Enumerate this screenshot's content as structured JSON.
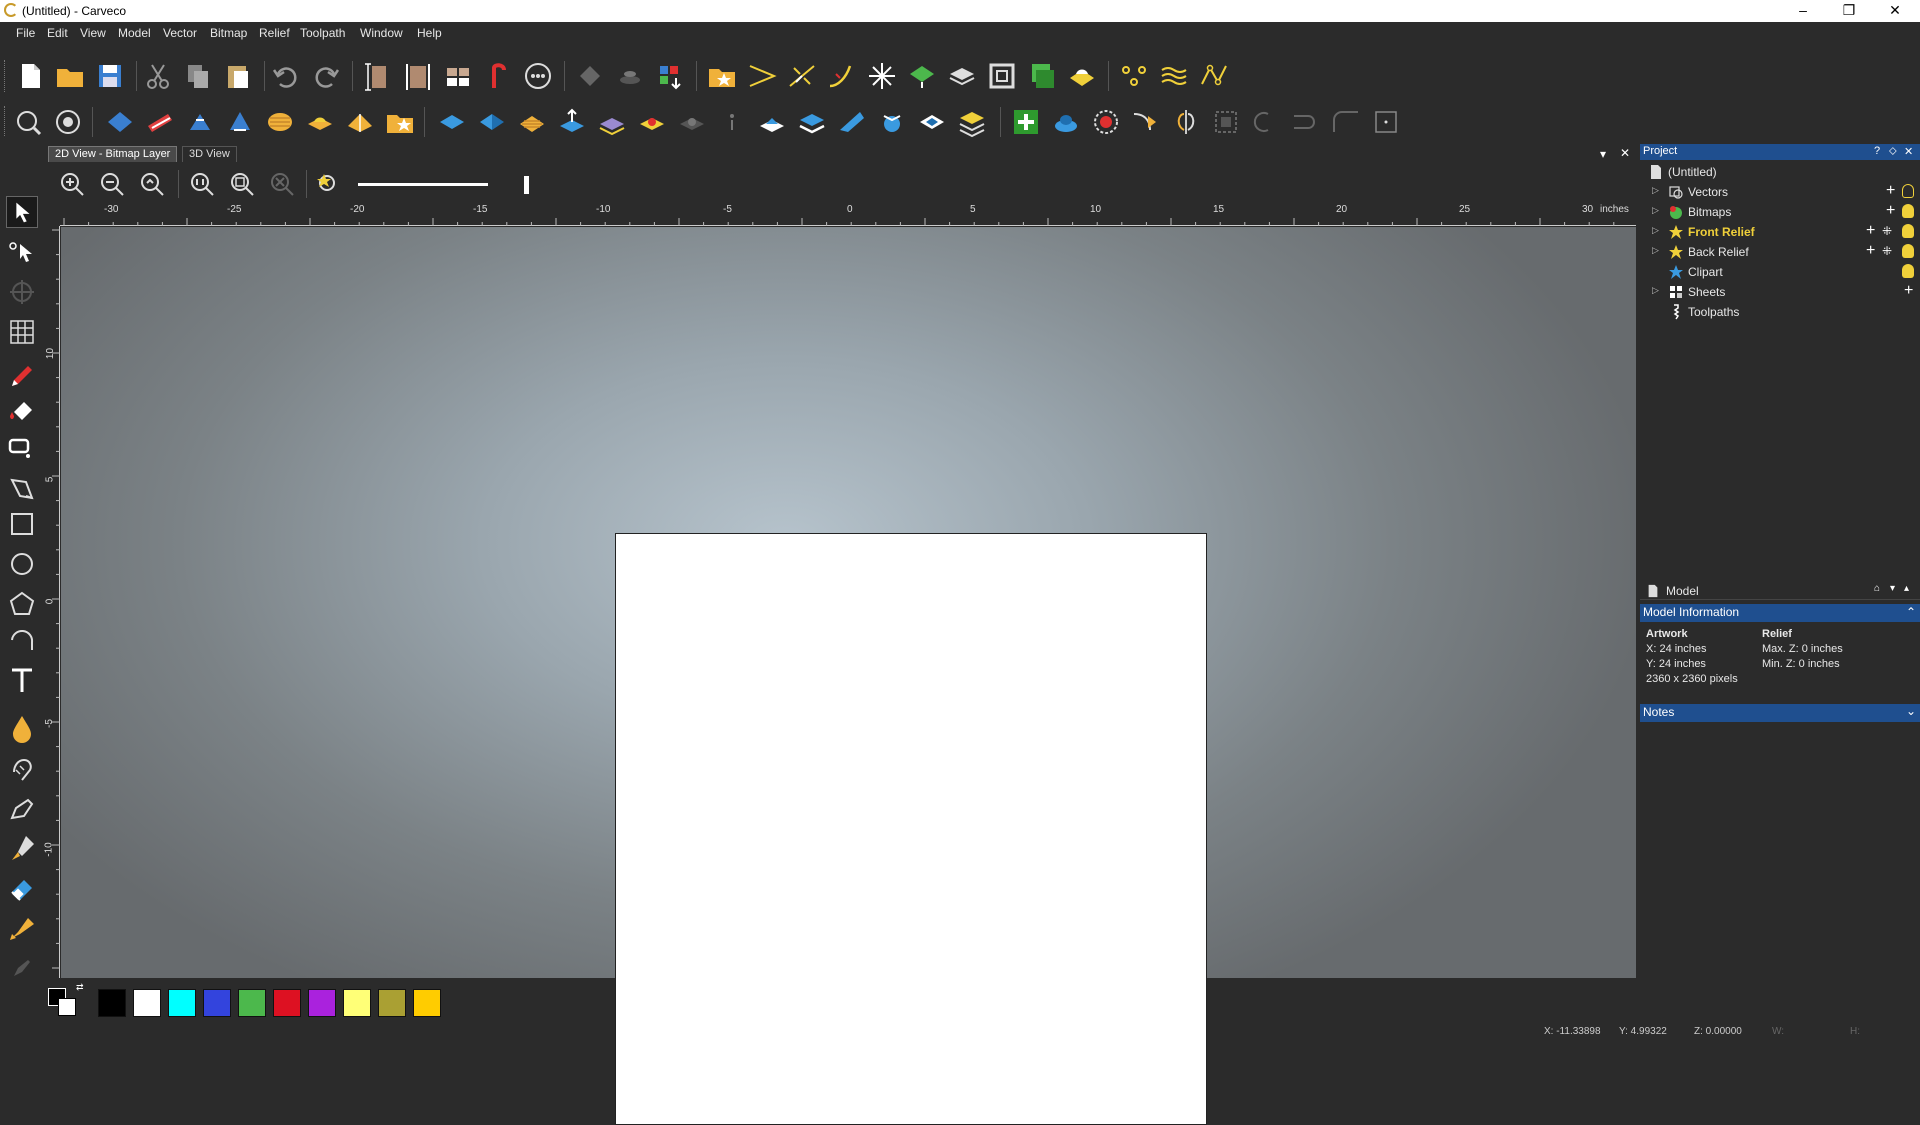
{
  "window": {
    "title": "(Untitled) - Carveco",
    "minimize": "–",
    "maximize": "❐",
    "close": "✕"
  },
  "menu": [
    "File",
    "Edit",
    "View",
    "Model",
    "Vector",
    "Bitmap",
    "Relief",
    "Toolpath",
    "Window",
    "Help"
  ],
  "tabs": {
    "active": "2D View - Bitmap Layer",
    "other": "3D View",
    "dropdown": "▾",
    "close": "✕"
  },
  "ruler": {
    "h_labels": [
      "-30",
      "-25",
      "-20",
      "-15",
      "-10",
      "-5",
      "0",
      "5",
      "10",
      "15",
      "20",
      "25",
      "30"
    ],
    "units": "inches",
    "v_labels": [
      "10",
      "5",
      "0",
      "-5",
      "-10"
    ]
  },
  "project": {
    "title": "Project",
    "help": "?",
    "pin": "⬦",
    "close": "✕",
    "root": "(Untitled)",
    "items": [
      {
        "label": "Vectors",
        "highlight": false
      },
      {
        "label": "Bitmaps",
        "highlight": false
      },
      {
        "label": "Front Relief",
        "highlight": true
      },
      {
        "label": "Back Relief",
        "highlight": false
      },
      {
        "label": "Clipart",
        "highlight": false
      },
      {
        "label": "Sheets",
        "highlight": false
      },
      {
        "label": "Toolpaths",
        "highlight": false
      }
    ]
  },
  "model_panel": {
    "title": "Model",
    "info_header": "Model Information",
    "artwork_heading": "Artwork",
    "artwork_x": "X: 24 inches",
    "artwork_y": "Y: 24 inches",
    "artwork_px": "2360 x 2360 pixels",
    "relief_heading": "Relief",
    "relief_max": "Max. Z: 0 inches",
    "relief_min": "Min. Z: 0 inches",
    "notes_header": "Notes"
  },
  "status": {
    "x": "X: -11.33898",
    "y": "Y: 4.99322",
    "z": "Z: 0.00000",
    "w": "W:",
    "h": "H:"
  },
  "palette": [
    "#000000",
    "#ffffff",
    "#00ffff",
    "#3344dd",
    "#4cb84c",
    "#dd1122",
    "#aa22dd",
    "#ffff77",
    "#aaa033",
    "#ffcc00"
  ],
  "colors": {
    "accent_blue": "#1f4f8f",
    "highlight_yellow": "#f0d03a"
  }
}
